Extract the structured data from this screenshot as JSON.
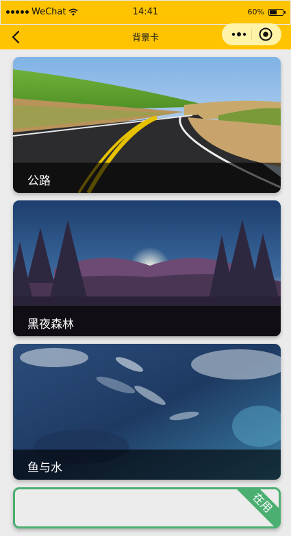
{
  "status_bar": {
    "carrier": "WeChat",
    "time": "14:41",
    "battery": "60%",
    "battery_level": 0.6
  },
  "nav": {
    "title": "背景卡",
    "back_icon": "chevron-left-icon",
    "more_icon": "more-dots-icon",
    "close_icon": "target-circle-icon"
  },
  "colors": {
    "nav_background": "#ffc300",
    "capsule": "#fff3a8",
    "selected_border": "#4caf72"
  },
  "cards": [
    {
      "title": "公路"
    },
    {
      "title": "黑夜森林"
    },
    {
      "title": "鱼与水"
    },
    {
      "title": "",
      "badge": "在用"
    }
  ]
}
